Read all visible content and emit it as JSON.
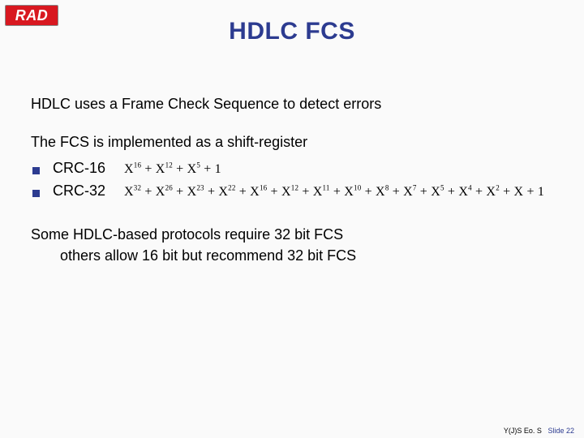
{
  "logo": {
    "text": "RAD"
  },
  "title": "HDLC FCS",
  "intro": "HDLC uses a Frame Check Sequence to detect errors",
  "shift_line": "The FCS is implemented as a shift-register",
  "crc": [
    {
      "label": "CRC-16",
      "exponents": [
        16,
        12,
        5,
        0
      ]
    },
    {
      "label": "CRC-32",
      "exponents": [
        32,
        26,
        23,
        22,
        16,
        12,
        11,
        10,
        8,
        7,
        5,
        4,
        2,
        1,
        0
      ]
    }
  ],
  "protocols": {
    "line1": "Some HDLC-based protocols require 32 bit FCS",
    "line2": "others allow 16 bit but recommend 32 bit FCS"
  },
  "footer": {
    "author": "Y(J)S Eo. S",
    "slide_label": "Slide",
    "slide_num": "22"
  }
}
